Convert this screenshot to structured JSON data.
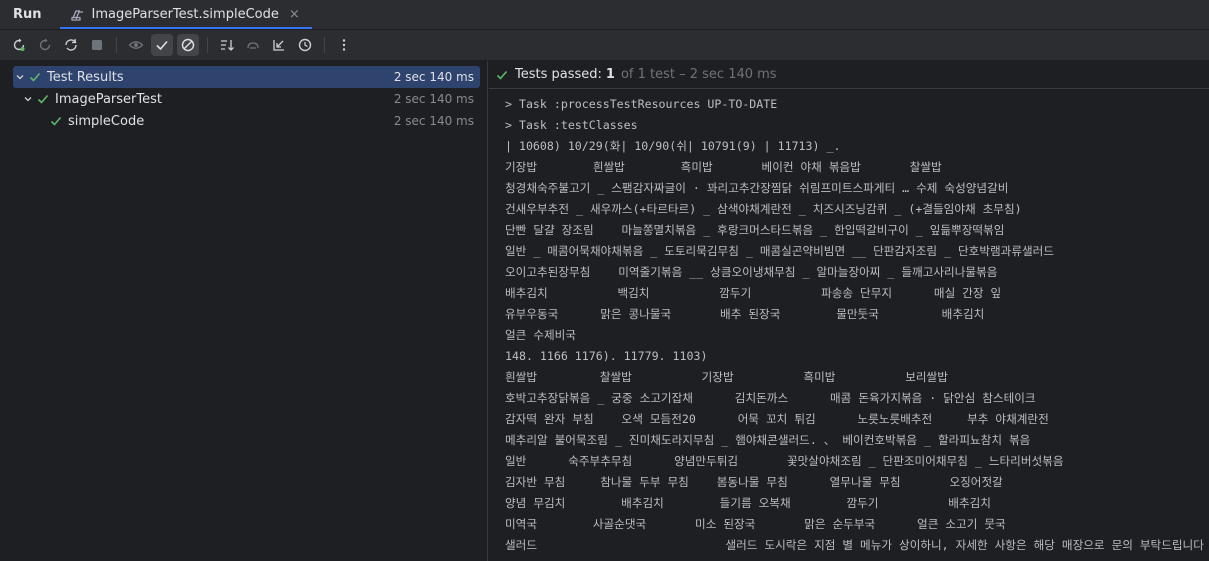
{
  "tabbar": {
    "run_label": "Run",
    "tab_title": "ImageParserTest.simpleCode",
    "close_glyph": "×"
  },
  "toolbar": {
    "icons": [
      "rerun-icon",
      "rerun-failed-icon",
      "toggle-auto-test-icon",
      "stop-icon",
      "show-ignored-icon",
      "show-passed-icon",
      "show-ignored-toggle-icon",
      "sort-icon",
      "collapse-icon",
      "export-icon",
      "history-icon",
      "more-icon"
    ]
  },
  "tree": {
    "rows": [
      {
        "name": "Test Results",
        "time": "2 sec 140 ms"
      },
      {
        "name": "ImageParserTest",
        "time": "2 sec 140 ms"
      },
      {
        "name": "simpleCode",
        "time": "2 sec 140 ms"
      }
    ]
  },
  "summary": {
    "label": "Tests passed:",
    "count": "1",
    "rest": "of 1 test – 2 sec 140 ms"
  },
  "console": {
    "lines": [
      "> Task :processTestResources UP-TO-DATE",
      "> Task :testClasses",
      "| 10608) 10/29(화| 10/90(쉬| 10791(9) | 11713) _.",
      "기장밥        흰쌀밥        흑미밥       베이컨 야채 볶음밥       찰쌀밥",
      "청경채숙주불고기 _ 스팸감자짜글이 · 꽈리고추간장찜닭 쉬림프미트스파게티 … 수제 숙성양념갈비",
      "건새우부추전 _ 새우까스(+타르타르) _ 삼색야채계란전 _ 치즈시즈닝감퀴 _ (+결들임야채 초무침)",
      "단빤 달걀 장조림    마늘쫑멸치볶음 _ 후랑크머스타드볶음 _ 한입떡갈비구이 _ 잎듦뿌장떡볶임",
      "일반 _ 매콤어묵채야채볶음 _ 도토리묵김무침 _ 매콤실곤약비빔면 __ 단판감자조림 _ 단호박램과류샐러드",
      "오이고추된장무침    미역줄기볶음 __ 상큼오이냉채무침 _ 알마늘장아찌 _ 들깨고사리나물볶음",
      "배추김치          백김치          깜두기          파송송 단무지      매실 간장 잎",
      "유부우동국      맑은 콩나물국       배추 된장국        물만둣국         배추김치",
      "얼큰 수제비국",
      "148. 1166 1176). 11779. 1103)",
      "흰쌀밥         찰쌀밥          기장밥          흑미밥          보리쌀밥",
      "호박고추장닭볶음 _ 궁중 소고기잡채      김치돈까스      매콤 돈육가지볶음 · 닭안심 참스테이크",
      "감자떡 완자 부침    오색 모듬전20      어묵 꼬치 튀김      노릇노릇배추전     부추 야채계란전",
      "메추리알 불어묵조림 _ 진미채도라지무침 _ 햄야채콘샐러드. 、 베이컨호박볶음 _ 할라피뇨참치 볶음",
      "일반      숙주부추무침      양념만두튀김       꽃맛살야채조림 _ 단판조미어채무침 _ 느타리버섯볶음",
      "김자반 무침     참나물 두부 무침    봄동나물 무침      열무나물 무침       오징어젓갈",
      "양념 무김치        배추김치        들기름 오복채        깜두기          배추김치",
      "미역국        사골순댓국       미소 된장국       맑은 순두부국      얼큰 소고기 뭇국",
      "샐러드                           샐러드 도시락은 지점 별 메뉴가 상이하니, 자세한 사항은 해당 매장으로 문의 부탁드립니다."
    ]
  },
  "colors": {
    "accent": "#3574f0",
    "pass_green": "#5fb865",
    "selection": "#2e436e"
  }
}
